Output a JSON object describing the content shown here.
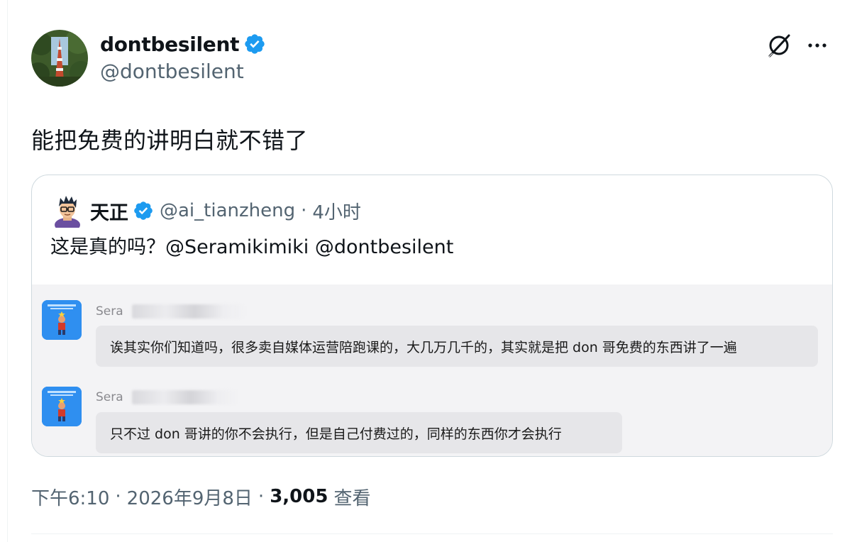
{
  "author": {
    "display_name": "dontbesilent",
    "handle": "@dontbesilent",
    "verified": true,
    "avatar_icon": "tower-photo-avatar"
  },
  "header_actions": {
    "grok_icon": "grok-slash-icon",
    "more_icon": "more-dots-icon"
  },
  "tweet": {
    "text": "能把免费的讲明白就不错了"
  },
  "quoted": {
    "display_name": "天正",
    "handle": "@ai_tianzheng",
    "separator": "·",
    "time": "4小时",
    "text": "这是真的吗？@Seramikimiki @dontbesilent",
    "chat": [
      {
        "sender": "Sera",
        "message": "诶其实你们知道吗，很多卖自媒体运营陪跑课的，大几万几千的，其实就是把 don 哥免费的东西讲了一遍"
      },
      {
        "sender": "Sera",
        "message": "只不过 don 哥讲的你不会执行，但是自己付费过的，同样的东西你才会执行"
      }
    ]
  },
  "meta": {
    "time": "下午6:10",
    "separator": "·",
    "date": "2026年9月8日",
    "views": "3,005",
    "views_label": "查看"
  },
  "colors": {
    "verified_blue": "#1d9bf0",
    "secondary_text": "#536471",
    "border": "#cfd9de"
  }
}
